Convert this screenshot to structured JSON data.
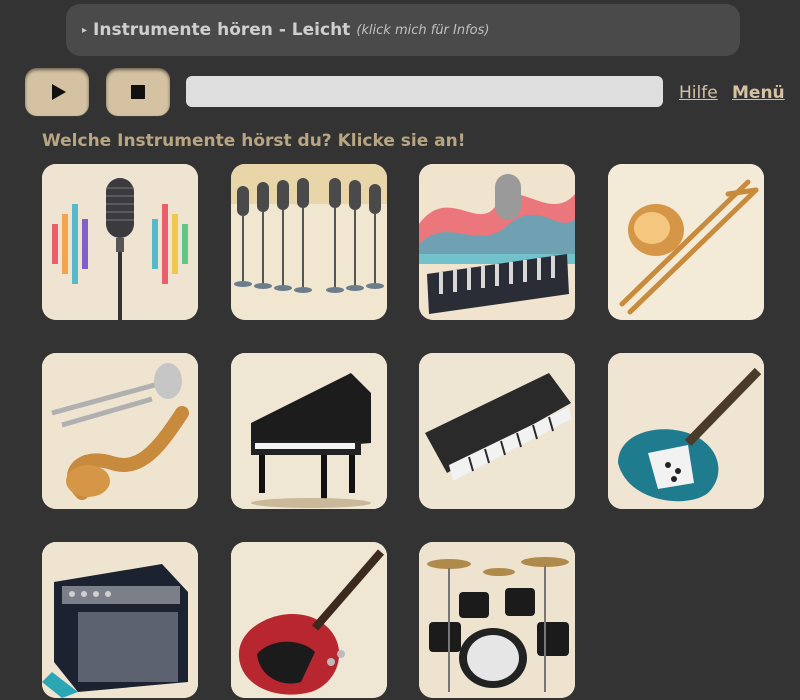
{
  "header": {
    "arrow": "▸",
    "title": "Instrumente hören - Leicht",
    "hint": "(klick mich für Infos)"
  },
  "controls": {
    "play_icon": "play-icon",
    "stop_icon": "stop-icon",
    "progress": 0
  },
  "links": {
    "help": "Hilfe",
    "menu": "Menü"
  },
  "question": "Welche Instrumente hörst du? Klicke sie an!",
  "instruments": [
    {
      "id": "microphone",
      "icon": "microphone-icon"
    },
    {
      "id": "choir-microphones",
      "icon": "microphones-icon"
    },
    {
      "id": "mixer",
      "icon": "mixing-console-icon"
    },
    {
      "id": "trombone",
      "icon": "trombone-icon"
    },
    {
      "id": "brass",
      "icon": "trumpet-saxophone-icon"
    },
    {
      "id": "grand-piano",
      "icon": "grand-piano-icon"
    },
    {
      "id": "synthesizer",
      "icon": "keyboard-icon"
    },
    {
      "id": "electric-guitar",
      "icon": "electric-guitar-icon"
    },
    {
      "id": "amplifier",
      "icon": "amplifier-icon"
    },
    {
      "id": "bass-guitar",
      "icon": "bass-guitar-icon"
    },
    {
      "id": "drums",
      "icon": "drum-kit-icon"
    }
  ],
  "colors": {
    "background": "#333333",
    "accent": "#d4c2a2",
    "question": "#b8a581",
    "infobar": "#4a4a4a"
  }
}
